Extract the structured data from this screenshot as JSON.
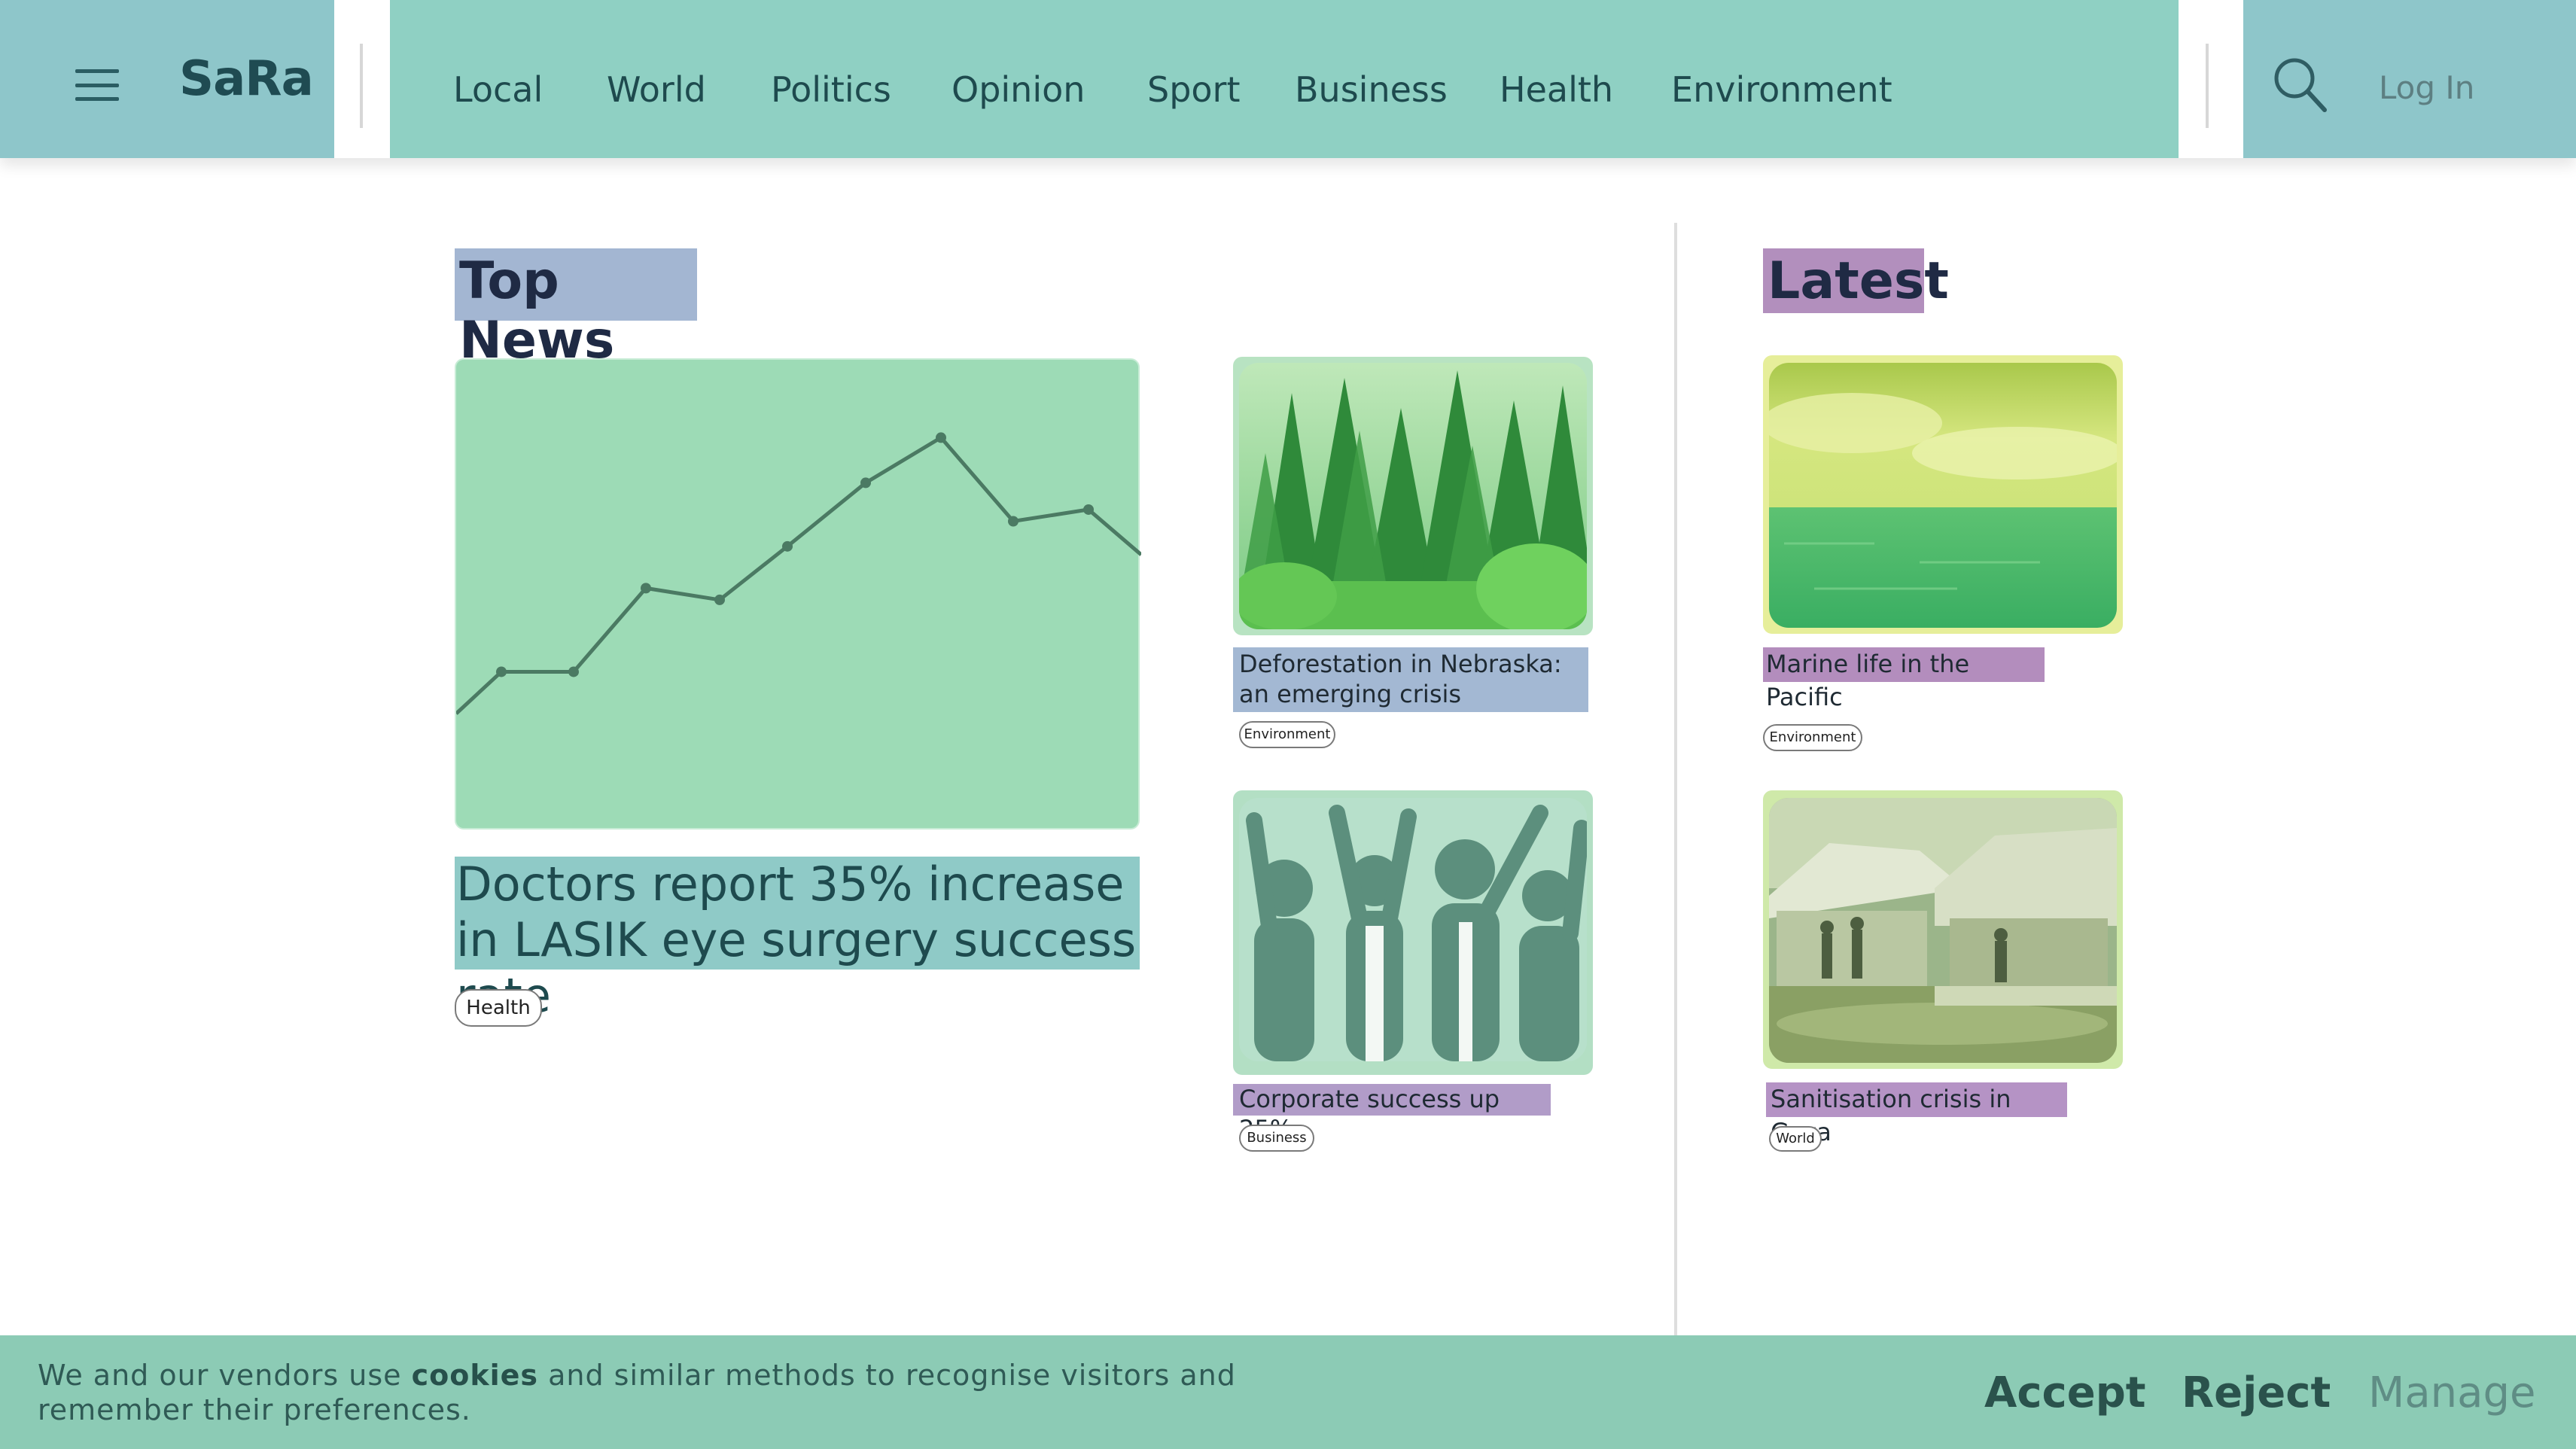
{
  "header": {
    "logo": "SaRa",
    "nav": [
      "Local",
      "World",
      "Politics",
      "Opinion",
      "Sport",
      "Business",
      "Health",
      "Environment"
    ],
    "login": "Log In"
  },
  "top_news": {
    "title": "Top News",
    "featured": {
      "headline": "Doctors report 35% increase in LASIK eye surgery success rate",
      "tag": "Health",
      "chart_data": {
        "type": "line",
        "values": [
          0,
          2.5,
          2.5,
          7.5,
          6.8,
          10,
          13.8,
          16.5,
          11.5,
          12.2,
          9.5
        ]
      }
    },
    "side": [
      {
        "headline": "Deforestation in Nebraska: an emerging crisis",
        "tag": "Environment",
        "image": "forest-photo"
      },
      {
        "headline": "Corporate success up 25%",
        "tag": "Business",
        "image": "celebration-photo"
      }
    ]
  },
  "latest": {
    "title": "Latest",
    "items": [
      {
        "headline": "Marine life in the Pacific",
        "tag": "Environment",
        "image": "ocean-photo"
      },
      {
        "headline": "Sanitisation crisis in Gaza",
        "tag": "World",
        "image": "camp-photo"
      }
    ]
  },
  "cookie": {
    "text_before": "We and our vendors use ",
    "text_bold": "cookies",
    "text_after": " and similar methods to recognise visitors and remember their preferences.",
    "accept": "Accept",
    "reject": "Reject",
    "manage": "Manage"
  },
  "colors": {
    "brand": "#8ec6ca",
    "nav": "#8fd0c3",
    "cookie": "#8ccbb5"
  }
}
